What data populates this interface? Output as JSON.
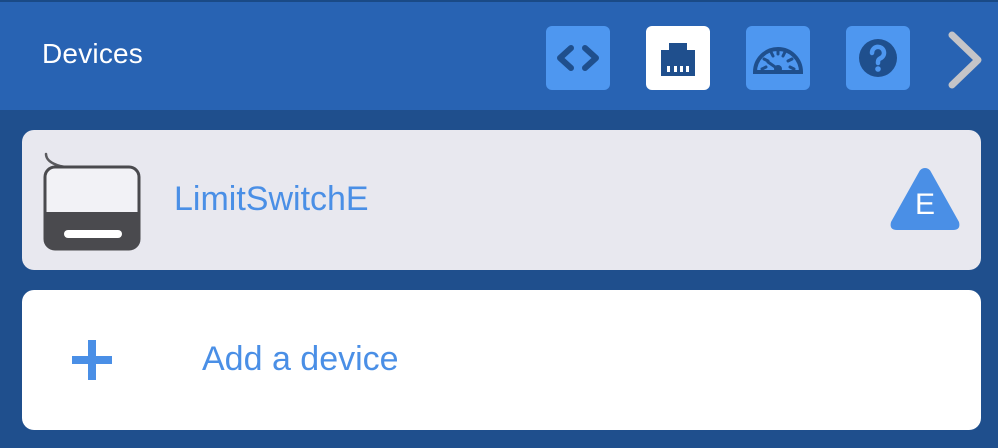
{
  "header": {
    "title": "Devices",
    "buttons": [
      {
        "id": "code",
        "icon": "code-brackets-icon",
        "active": false
      },
      {
        "id": "network",
        "icon": "ethernet-port-icon",
        "active": true
      },
      {
        "id": "gauge",
        "icon": "speedometer-icon",
        "active": false
      },
      {
        "id": "help",
        "icon": "question-mark-icon",
        "active": false
      }
    ],
    "next_icon": "chevron-right-icon"
  },
  "devices": [
    {
      "name": "LimitSwitchE",
      "icon": "limit-switch-icon",
      "badge": "E"
    }
  ],
  "add_device": {
    "label": "Add a device",
    "icon": "plus-icon"
  },
  "colors": {
    "header_bg": "#2863b3",
    "page_bg": "#1f4f8d",
    "button_bg": "#4e97f0",
    "accent_text": "#4a8fe6",
    "card_bg": "#e8e8ef"
  }
}
